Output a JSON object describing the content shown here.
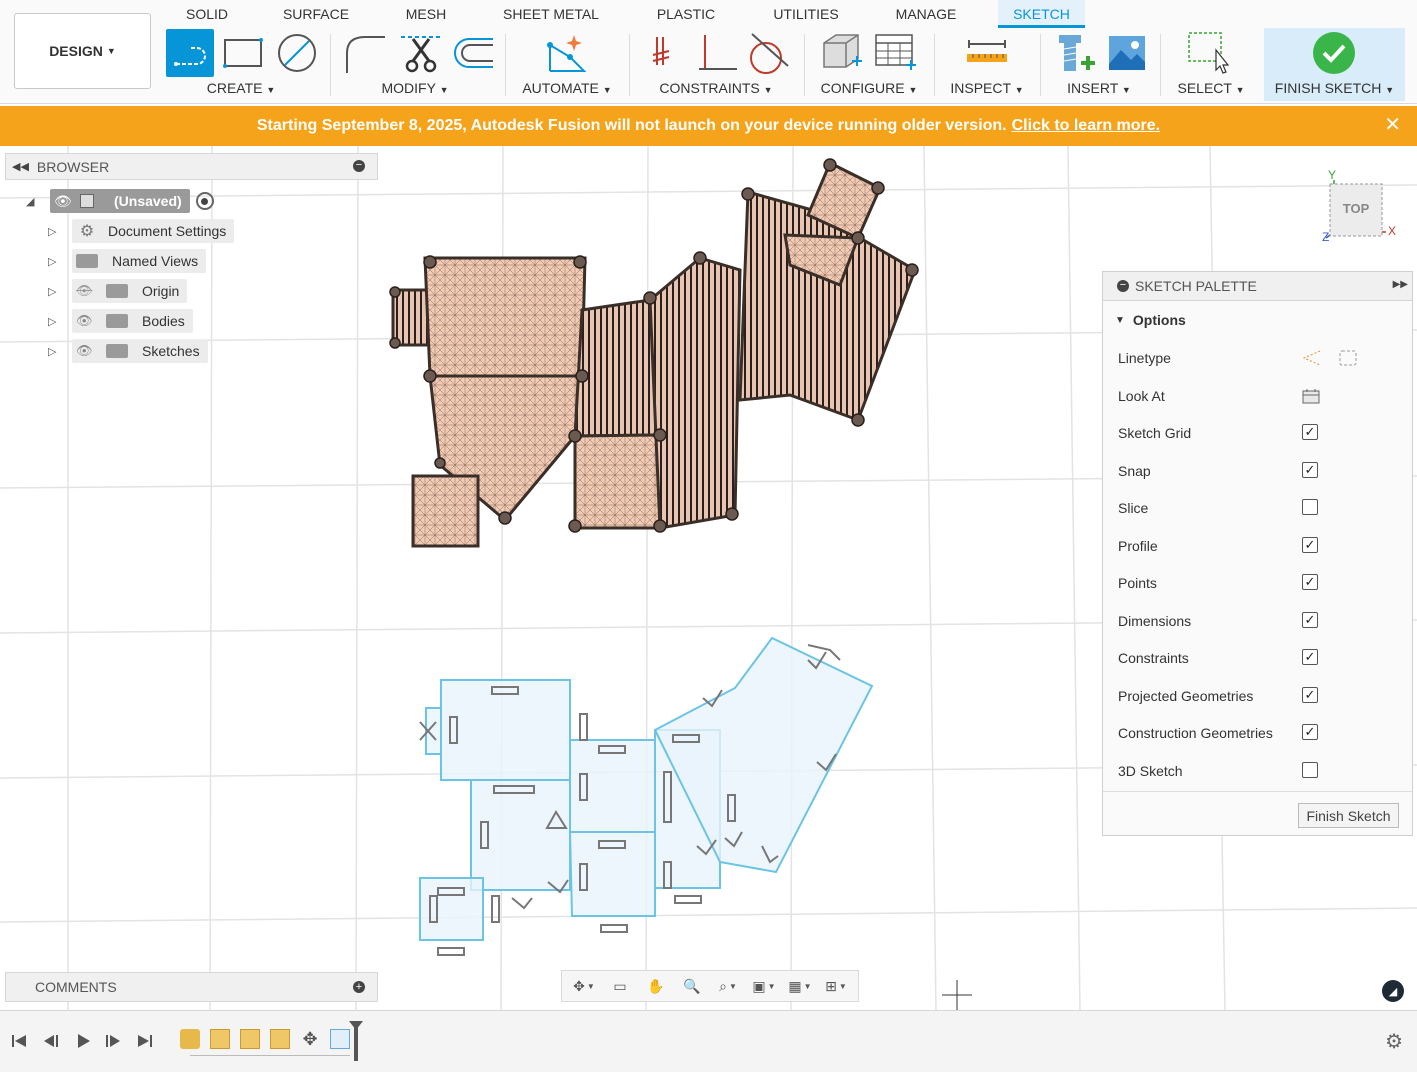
{
  "toolbar": {
    "workspace_label": "DESIGN",
    "tabs": [
      {
        "label": "SOLID"
      },
      {
        "label": "SURFACE"
      },
      {
        "label": "MESH"
      },
      {
        "label": "SHEET METAL"
      },
      {
        "label": "PLASTIC"
      },
      {
        "label": "UTILITIES"
      },
      {
        "label": "MANAGE"
      },
      {
        "label": "SKETCH"
      }
    ],
    "active_tab": "SKETCH",
    "groups": {
      "create": "CREATE",
      "modify": "MODIFY",
      "automate": "AUTOMATE",
      "constraints": "CONSTRAINTS",
      "configure": "CONFIGURE",
      "inspect": "INSPECT",
      "insert": "INSERT",
      "select": "SELECT",
      "finish": "FINISH SKETCH"
    },
    "accent_color": "#0696d7"
  },
  "banner": {
    "message": "Starting September 8, 2025, Autodesk Fusion will not launch on your device running older version.",
    "link": "Click to learn more.",
    "background_color": "#f5a31a"
  },
  "browser": {
    "title": "BROWSER",
    "root": "(Unsaved)",
    "items": [
      {
        "label": "Document Settings",
        "icon": "gear-icon"
      },
      {
        "label": "Named Views",
        "icon": "folder-icon"
      },
      {
        "label": "Origin",
        "icon": "folder-icon",
        "visibility": "hidden"
      },
      {
        "label": "Bodies",
        "icon": "folder-icon",
        "visibility": "visible"
      },
      {
        "label": "Sketches",
        "icon": "folder-icon",
        "visibility": "visible"
      }
    ]
  },
  "comments": {
    "title": "COMMENTS"
  },
  "viewcube": {
    "face": "TOP",
    "axes": {
      "y": "Y",
      "x": "X",
      "z": "Z"
    }
  },
  "palette": {
    "title": "SKETCH PALETTE",
    "section": "Options",
    "rows": [
      {
        "label": "Linetype",
        "control": "linetype-icons"
      },
      {
        "label": "Look At",
        "control": "look-at-icon"
      },
      {
        "label": "Sketch Grid",
        "checked": true
      },
      {
        "label": "Snap",
        "checked": true
      },
      {
        "label": "Slice",
        "checked": false
      },
      {
        "label": "Profile",
        "checked": true
      },
      {
        "label": "Points",
        "checked": true
      },
      {
        "label": "Dimensions",
        "checked": true
      },
      {
        "label": "Constraints",
        "checked": true
      },
      {
        "label": "Projected Geometries",
        "checked": true
      },
      {
        "label": "Construction Geometries",
        "checked": true
      },
      {
        "label": "3D Sketch",
        "checked": false
      }
    ],
    "finish_button": "Finish Sketch"
  }
}
